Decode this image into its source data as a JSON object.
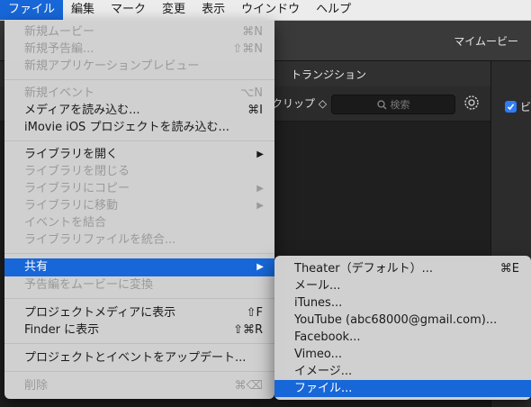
{
  "menubar": {
    "items": [
      "ファイル",
      "編集",
      "マーク",
      "変更",
      "表示",
      "ウインドウ",
      "ヘルプ"
    ]
  },
  "window": {
    "title": "マイムービー",
    "tab_transition": "トランジション",
    "clip_label": "クリップ ◇",
    "search_placeholder": "検索",
    "video_check_label": "ビ"
  },
  "file_menu": {
    "items": [
      {
        "label": "新規ムービー",
        "shortcut": "⌘N",
        "disabled": true
      },
      {
        "label": "新規予告編...",
        "shortcut": "⇧⌘N",
        "disabled": true
      },
      {
        "label": "新規アプリケーションプレビュー",
        "shortcut": "",
        "disabled": true
      },
      {
        "label": "新規イベント",
        "shortcut": "⌥N",
        "disabled": true
      },
      {
        "label": "メディアを読み込む...",
        "shortcut": "⌘I",
        "disabled": false
      },
      {
        "label": "iMovie iOS プロジェクトを読み込む...",
        "shortcut": "",
        "disabled": false
      },
      {
        "label": "ライブラリを開く",
        "shortcut": "",
        "disabled": false,
        "submenu": true
      },
      {
        "label": "ライブラリを閉じる",
        "shortcut": "",
        "disabled": true
      },
      {
        "label": "ライブラリにコピー",
        "shortcut": "",
        "disabled": true,
        "submenu": true
      },
      {
        "label": "ライブラリに移動",
        "shortcut": "",
        "disabled": true,
        "submenu": true
      },
      {
        "label": "イベントを結合",
        "shortcut": "",
        "disabled": true
      },
      {
        "label": "ライブラリファイルを統合...",
        "shortcut": "",
        "disabled": true
      },
      {
        "label": "共有",
        "shortcut": "",
        "disabled": false,
        "submenu": true,
        "selected": true
      },
      {
        "label": "予告編をムービーに変換",
        "shortcut": "",
        "disabled": true
      },
      {
        "label": "プロジェクトメディアに表示",
        "shortcut": "⇧F",
        "disabled": false
      },
      {
        "label": "Finder に表示",
        "shortcut": "⇧⌘R",
        "disabled": false
      },
      {
        "label": "プロジェクトとイベントをアップデート...",
        "shortcut": "",
        "disabled": false
      },
      {
        "label": "削除",
        "shortcut": "⌘⌫",
        "disabled": true
      }
    ],
    "submenu_arrow": "▶"
  },
  "share_menu": {
    "items": [
      {
        "label": "Theater（デフォルト）...",
        "shortcut": "⌘E"
      },
      {
        "label": "メール...",
        "shortcut": ""
      },
      {
        "label": "iTunes...",
        "shortcut": ""
      },
      {
        "label": "YouTube (abc68000@gmail.com)...",
        "shortcut": ""
      },
      {
        "label": "Facebook...",
        "shortcut": ""
      },
      {
        "label": "Vimeo...",
        "shortcut": ""
      },
      {
        "label": "イメージ...",
        "shortcut": ""
      },
      {
        "label": "ファイル...",
        "shortcut": "",
        "selected": true
      }
    ]
  }
}
